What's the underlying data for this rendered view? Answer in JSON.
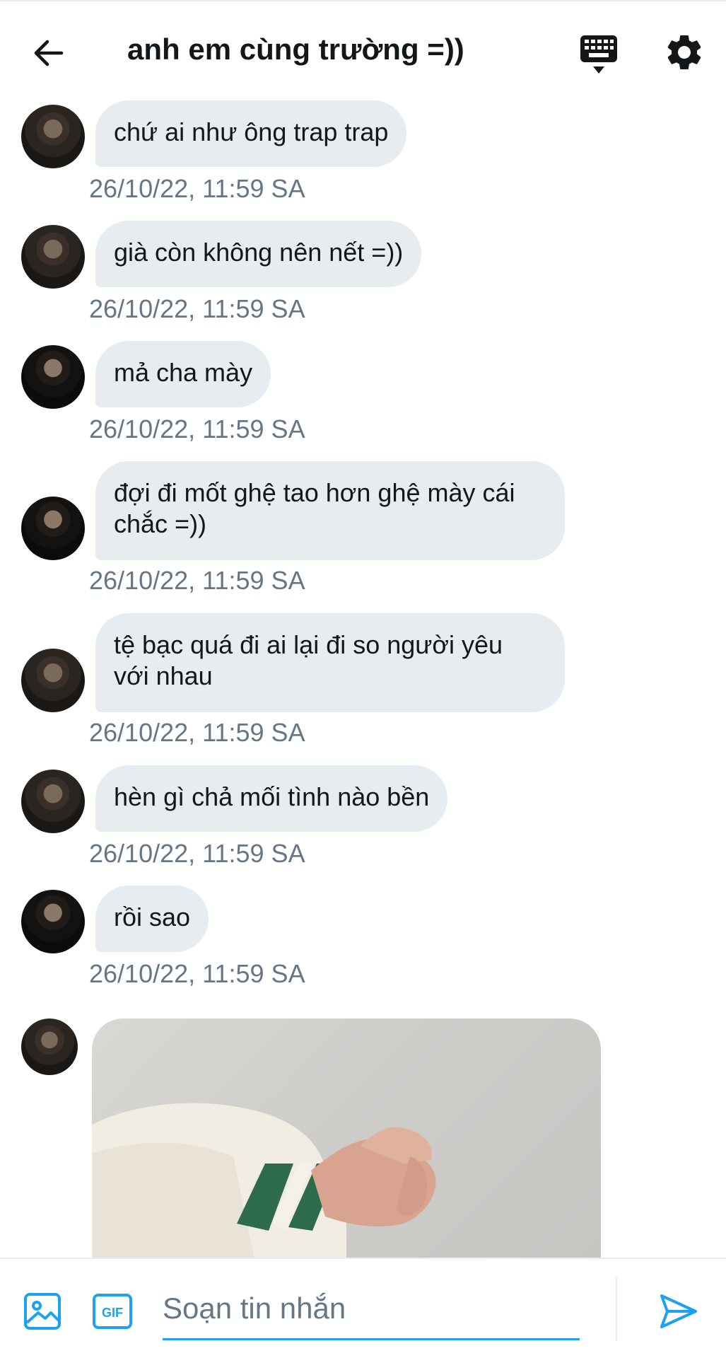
{
  "header": {
    "title": "anh em cùng trường =))",
    "icons": [
      "arrow-left-icon",
      "keyboard-icon",
      "gear-icon"
    ]
  },
  "messages": [
    {
      "text": "chứ ai như ông trap trap",
      "time": "26/10/22, 11:59 SA",
      "avatar": "a"
    },
    {
      "text": "già còn không nên nết =))",
      "time": "26/10/22, 11:59 SA",
      "avatar": "a"
    },
    {
      "text": "mả cha mày",
      "time": "26/10/22, 11:59 SA",
      "avatar": "b"
    },
    {
      "text": "đợi đi mốt ghệ tao hơn ghệ mày cái\nchắc =))",
      "time": "26/10/22, 11:59 SA",
      "avatar": "b"
    },
    {
      "text": "tệ bạc quá đi ai lại đi so người yêu\nvới nhau",
      "time": "26/10/22, 11:59 SA",
      "avatar": "a"
    },
    {
      "text": "hèn gì chả mối tình nào bền",
      "time": "26/10/22, 11:59 SA",
      "avatar": "a"
    },
    {
      "text": "rồi sao",
      "time": "26/10/22, 11:59 SA",
      "avatar": "b"
    }
  ],
  "photo_message": {
    "avatar": "a",
    "content": "photo of two holding hands"
  },
  "composer": {
    "placeholder": "Soạn tin nhắn",
    "gif_label": "GIF",
    "icons": [
      "image-icon",
      "gif-icon",
      "send-icon"
    ]
  },
  "colors": {
    "accent": "#1da1f2",
    "bubble": "#e6ecf0",
    "timestamp": "#657786",
    "text": "#14171a"
  }
}
